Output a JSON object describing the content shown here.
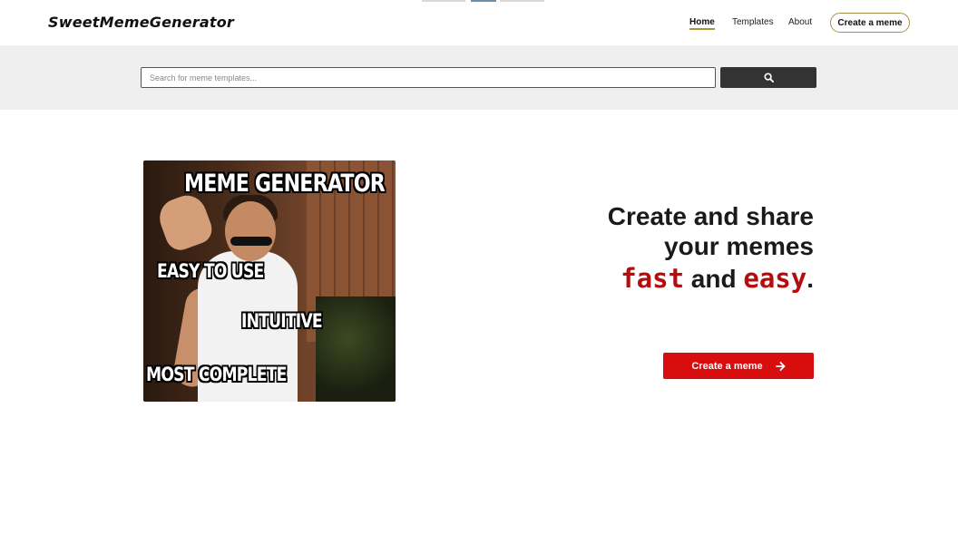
{
  "header": {
    "logo": "SweetMemeGenerator",
    "nav": [
      {
        "label": "Home",
        "active": true
      },
      {
        "label": "Templates",
        "active": false
      },
      {
        "label": "About",
        "active": false
      }
    ],
    "cta_label": "Create a meme"
  },
  "search": {
    "placeholder": "Search for meme templates...",
    "value": "",
    "button_icon": "search-icon"
  },
  "hero": {
    "image": {
      "top_text": "MEME GENERATOR",
      "text_1": "EASY TO USE",
      "text_2": "INTUITIVE",
      "text_3": "MOST COMPLETE"
    },
    "title_line1": "Create and share",
    "title_line2": "your memes",
    "word_fast": "fast",
    "word_and": " and ",
    "word_easy": "easy",
    "word_dot": ".",
    "cta_label": "Create a meme",
    "cta_icon": "arrow-right-icon"
  },
  "colors": {
    "accent_red": "#d80e0e",
    "dark_red_text": "#b50d0d",
    "search_button": "#333333",
    "search_band": "#efefef",
    "cta_border": "#a89248"
  }
}
